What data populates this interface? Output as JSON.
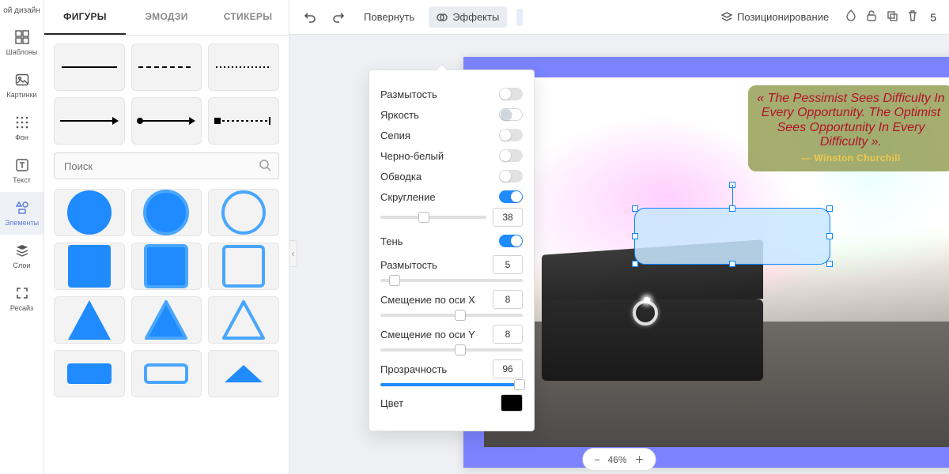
{
  "rail": {
    "top": "ой дизайн",
    "items": [
      {
        "label": "Шаблоны",
        "icon": "templates-icon"
      },
      {
        "label": "Картинки",
        "icon": "image-icon"
      },
      {
        "label": "Фон",
        "icon": "grid-icon"
      },
      {
        "label": "Текст",
        "icon": "text-icon"
      },
      {
        "label": "Элементы",
        "icon": "shapes-icon",
        "active": true
      },
      {
        "label": "Слои",
        "icon": "layers-icon"
      },
      {
        "label": "Ресайз",
        "icon": "resize-icon"
      }
    ]
  },
  "panel": {
    "tabs": [
      "ФИГУРЫ",
      "ЭМОДЗИ",
      "СТИКЕРЫ"
    ],
    "active_tab": 0,
    "search_placeholder": "Поиск"
  },
  "toolbar": {
    "rotate": "Повернуть",
    "effects": "Эффекты",
    "position": "Позиционирование",
    "right_count": "5"
  },
  "effects": {
    "blur": {
      "label": "Размытость",
      "on": false
    },
    "brightness": {
      "label": "Яркость",
      "on": false,
      "outlined": true
    },
    "sepia": {
      "label": "Сепия",
      "on": false
    },
    "bw": {
      "label": "Черно-белый",
      "on": false
    },
    "stroke": {
      "label": "Обводка",
      "on": false
    },
    "round": {
      "label": "Скругление",
      "on": true,
      "value": "38"
    },
    "shadow": {
      "label": "Тень",
      "on": true
    },
    "shadow_blur": {
      "label": "Размытость",
      "value": "5"
    },
    "offx": {
      "label": "Смещение по оси X",
      "value": "8"
    },
    "offy": {
      "label": "Смещение по оси Y",
      "value": "8"
    },
    "opacity": {
      "label": "Прозрачность",
      "value": "96"
    },
    "color": {
      "label": "Цвет",
      "hex": "#000000"
    }
  },
  "canvas": {
    "quote": "« The Pessimist Sees Difficulty In Every Opportunity. The Optimist Sees Opportunity In Every Difficulty ».",
    "author": "— Winston Churchill",
    "zoom": "46%"
  },
  "colors": {
    "accent": "#1f8bff",
    "frame": "#7b83ff"
  }
}
